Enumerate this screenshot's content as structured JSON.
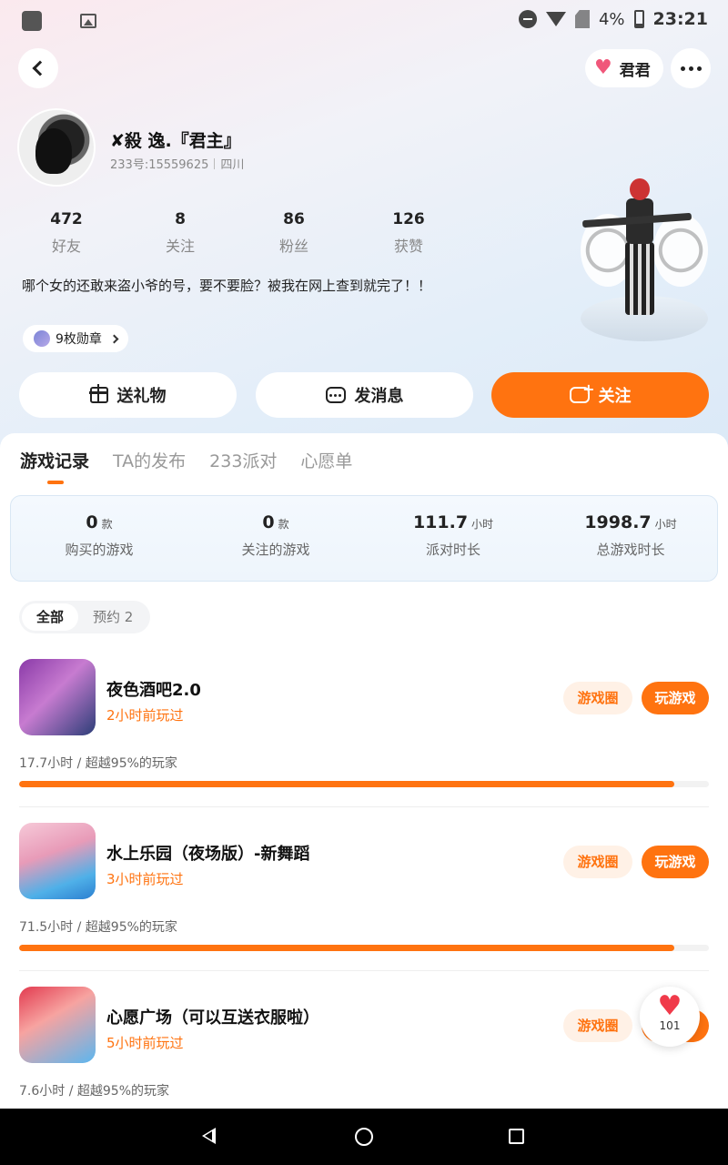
{
  "status_bar": {
    "battery": "4%",
    "time": "23:21"
  },
  "header": {
    "friend_name": "君君"
  },
  "profile": {
    "name": "✘殺 逸.『君主』",
    "id_text": "233号:15559625",
    "location": "四川",
    "stats": [
      {
        "value": "472",
        "label": "好友"
      },
      {
        "value": "8",
        "label": "关注"
      },
      {
        "value": "86",
        "label": "粉丝"
      },
      {
        "value": "126",
        "label": "获赞"
      }
    ],
    "bio": "哪个女的还敢来盗小爷的号，要不要脸？被我在网上查到就完了！！",
    "badges": "9枚勋章"
  },
  "actions": {
    "gift": "送礼物",
    "message": "发消息",
    "follow": "关注"
  },
  "tabs": [
    "游戏记录",
    "TA的发布",
    "233派对",
    "心愿单"
  ],
  "summary": [
    {
      "value": "0",
      "unit": "款",
      "label": "购买的游戏"
    },
    {
      "value": "0",
      "unit": "款",
      "label": "关注的游戏"
    },
    {
      "value": "111.7",
      "unit": "小时",
      "label": "派对时长"
    },
    {
      "value": "1998.7",
      "unit": "小时",
      "label": "总游戏时长"
    }
  ],
  "filters": [
    "全部",
    "预约 2"
  ],
  "games": [
    {
      "name": "夜色酒吧2.0",
      "last_played": "2小时前玩过",
      "circle": "游戏圈",
      "play": "玩游戏",
      "stats": "17.7小时 / 超越95%的玩家",
      "progress": 0.95
    },
    {
      "name": "水上乐园（夜场版）-新舞蹈",
      "last_played": "3小时前玩过",
      "circle": "游戏圈",
      "play": "玩游戏",
      "stats": "71.5小时 / 超越95%的玩家",
      "progress": 0.95
    },
    {
      "name": "心愿广场（可以互送衣服啦）",
      "last_played": "5小时前玩过",
      "circle": "游戏圈",
      "play": "玩游戏",
      "stats": "7.6小时 / 超越95%的玩家",
      "progress": 0.95
    }
  ],
  "like_fab": {
    "count": "101"
  },
  "colors": {
    "accent": "#ff7310",
    "like": "#f03a4a"
  }
}
